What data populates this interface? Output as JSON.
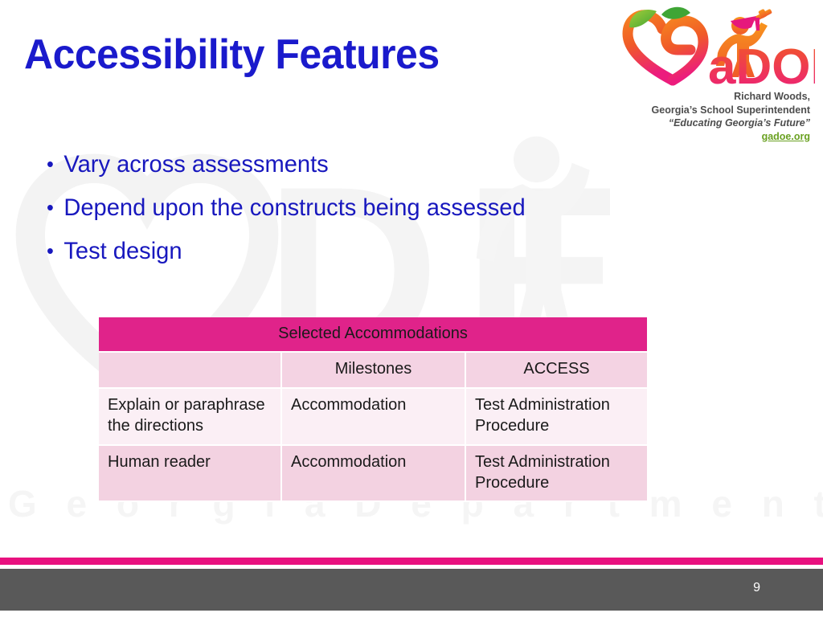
{
  "slide": {
    "title": "Accessibility Features",
    "page_number": "9",
    "title_color": "#1A1ACC",
    "bullet_color": "#1818BE",
    "accent_pink": "#E0238A",
    "footer_gray": "#595959"
  },
  "logo": {
    "mark_name": "gadoe-peach-logo",
    "wordmark": "aDOE",
    "superintendent_name": "Richard Woods,",
    "superintendent_title": "Georgia’s School Superintendent",
    "motto": "“Educating Georgia’s Future”",
    "url": "gadoe.org"
  },
  "watermark": {
    "letters": "DE",
    "tagline": "G e o r g i a   D e p a r t m e n t   o f   E d u c a t i o n"
  },
  "bullets": {
    "marker": "•",
    "items": [
      "Vary across assessments",
      "Depend upon the constructs being assessed",
      "Test design"
    ]
  },
  "table": {
    "caption": "Selected Accommodations",
    "column_headers": [
      "",
      "Milestones",
      "ACCESS"
    ],
    "rows": [
      {
        "feature": "Explain or paraphrase the directions",
        "milestones": "Accommodation",
        "access": "Test Administration Procedure"
      },
      {
        "feature": "Human reader",
        "milestones": "Accommodation",
        "access": "Test Administration Procedure"
      }
    ]
  }
}
